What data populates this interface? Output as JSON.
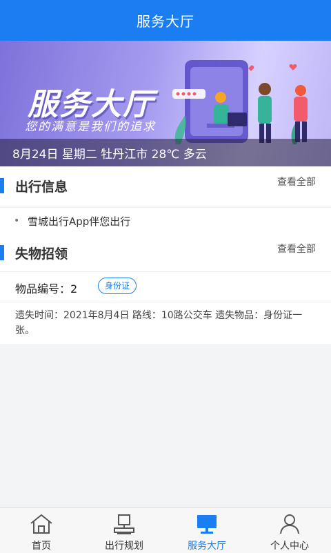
{
  "header": {
    "title": "服务大厅"
  },
  "banner": {
    "title": "服务大厅",
    "slogan": "您的满意是我们的追求",
    "info": "8月24日 星期二 牡丹江市 28℃ 多云"
  },
  "sections": {
    "travel": {
      "title": "出行信息",
      "view_all": "查看全部",
      "items": [
        "雪城出行App伴您出行"
      ]
    },
    "lost_found": {
      "title": "失物招领",
      "view_all": "查看全部",
      "item": {
        "label": "物品编号：2",
        "badge": "身份证",
        "description": "遗失时间：2021年8月4日 路线：10路公交车 遗失物品：身份证一张。"
      }
    }
  },
  "tabbar": {
    "items": [
      {
        "label": "首页",
        "icon": "home-icon"
      },
      {
        "label": "出行规划",
        "icon": "bus-stop-icon"
      },
      {
        "label": "服务大厅",
        "icon": "monitor-icon"
      },
      {
        "label": "个人中心",
        "icon": "user-icon"
      }
    ],
    "active_index": 2,
    "active_color": "#1a7ef2"
  },
  "colors": {
    "accent": "#1a7ef2"
  }
}
